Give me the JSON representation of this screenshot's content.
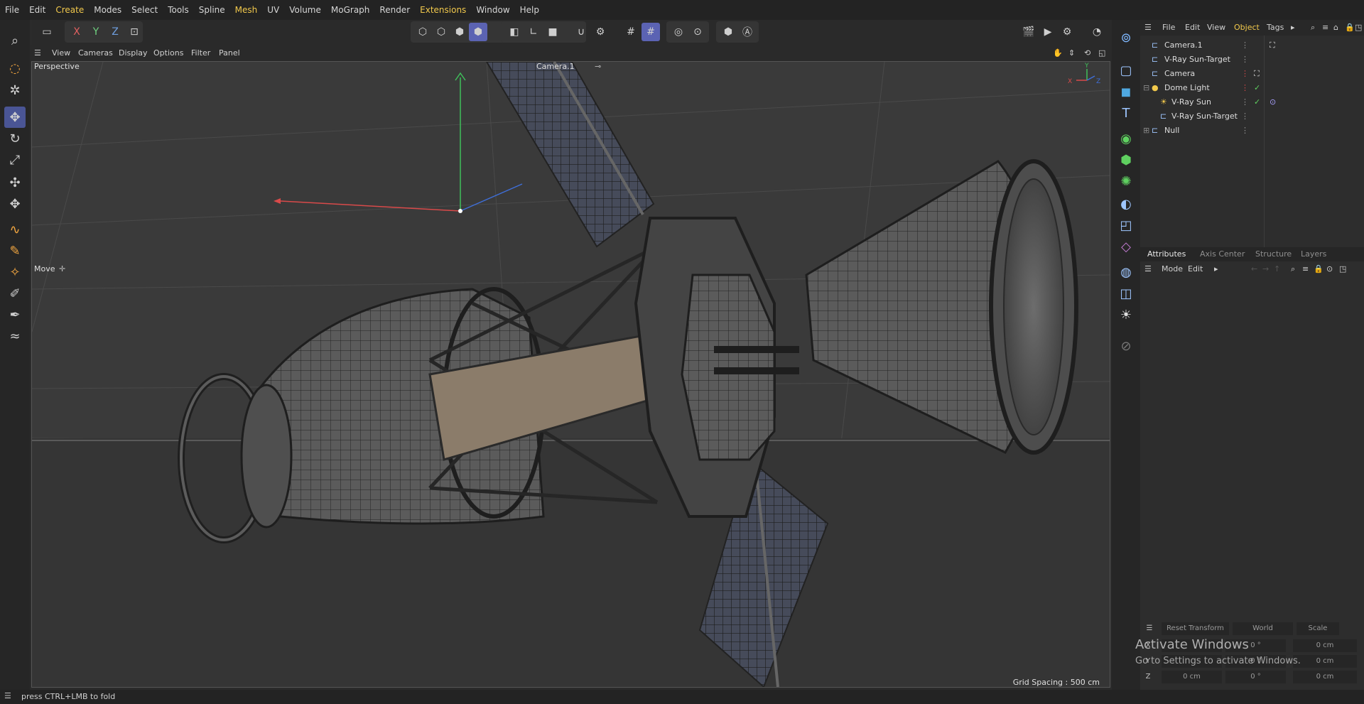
{
  "menu": [
    "File",
    "Edit",
    "Create",
    "Modes",
    "Select",
    "Tools",
    "Spline",
    "Mesh",
    "UV",
    "Volume",
    "MoGraph",
    "Render",
    "Extensions",
    "Window",
    "Help"
  ],
  "menu_highlight": [
    "Create",
    "Mesh",
    "Extensions"
  ],
  "axes": {
    "x": "X",
    "y": "Y",
    "z": "Z"
  },
  "viewport_menu": {
    "view": "View",
    "cameras": "Cameras",
    "display": "Display",
    "options": "Options",
    "filter": "Filter",
    "panel": "Panel"
  },
  "viewport": {
    "name": "Perspective",
    "camera": "Camera.1",
    "tool": "Move",
    "grid_spacing": "Grid Spacing : 500 cm"
  },
  "object_menu": {
    "file": "File",
    "edit": "Edit",
    "view": "View",
    "object": "Object",
    "tags": "Tags"
  },
  "objects": [
    {
      "name": "Camera.1",
      "icon": "camera-icon",
      "indent": 0
    },
    {
      "name": "V-Ray Sun-Target",
      "icon": "target-icon",
      "indent": 0
    },
    {
      "name": "Camera",
      "icon": "camera-icon",
      "indent": 0
    },
    {
      "name": "Dome Light",
      "icon": "dome-light-icon",
      "indent": 0
    },
    {
      "name": "V-Ray Sun",
      "icon": "sun-icon",
      "indent": 1
    },
    {
      "name": "V-Ray Sun-Target",
      "icon": "target-icon",
      "indent": 1
    },
    {
      "name": "Null",
      "icon": "null-icon",
      "indent": 0
    }
  ],
  "attr_tabs": {
    "attributes": "Attributes",
    "axis_center": "Axis Center",
    "structure": "Structure",
    "layers": "Layers"
  },
  "attr_menu": {
    "mode": "Mode",
    "edit": "Edit"
  },
  "coord": {
    "reset": "Reset Transform",
    "space": "World",
    "scale": "Scale",
    "rows": [
      {
        "axis": "X",
        "pos": "",
        "rot": "0 °",
        "scale": "0 cm"
      },
      {
        "axis": "Y",
        "pos": "",
        "rot": "0 °",
        "scale": "0 cm"
      },
      {
        "axis": "Z",
        "pos": "0 cm",
        "rot": "0 °",
        "scale": "0 cm"
      }
    ]
  },
  "watermark": {
    "title": "Activate Windows",
    "subtitle": "Go to Settings to activate Windows."
  },
  "status": "press CTRL+LMB to fold",
  "colors": {
    "accent": "#5b63b3",
    "highlight": "#f2c94c",
    "axis_x": "#d94a4a",
    "axis_y": "#3fbf5a",
    "axis_z": "#3f6fd9"
  }
}
